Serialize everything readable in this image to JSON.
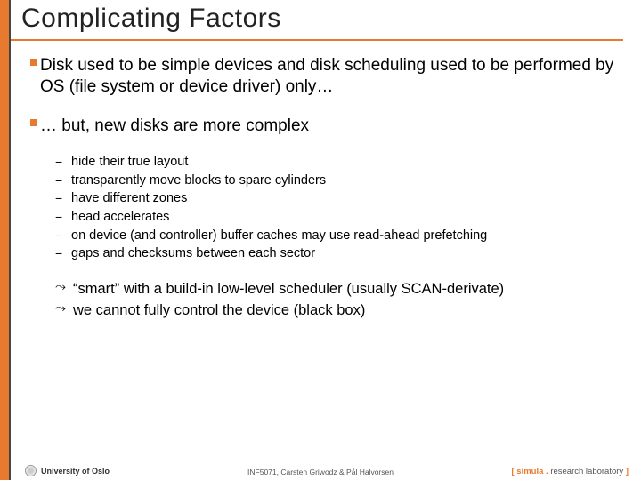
{
  "title": "Complicating Factors",
  "bullets": [
    {
      "text": "Disk used to be simple devices and disk scheduling used to be performed by OS (file system or device driver) only…"
    },
    {
      "text": "… but, new disks are more complex",
      "subs": [
        "hide their true layout",
        "transparently move blocks to spare cylinders",
        "have different zones",
        "head accelerates",
        "on device (and controller) buffer caches may use read-ahead prefetching",
        "gaps and checksums between each sector"
      ],
      "conclusions": [
        "“smart” with a build-in low-level scheduler (usually SCAN-derivate)",
        "we cannot fully control the device (black box)"
      ]
    }
  ],
  "marks": {
    "dash": "−",
    "arrow": "⤳"
  },
  "footer": {
    "uio": "University of Oslo",
    "center": "INF5071, Carsten Griwodz & Pål Halvorsen",
    "right": {
      "br1": "[ ",
      "sim": "simula",
      "dot": " . ",
      "rl": "research laboratory",
      "br2": " ]"
    }
  }
}
